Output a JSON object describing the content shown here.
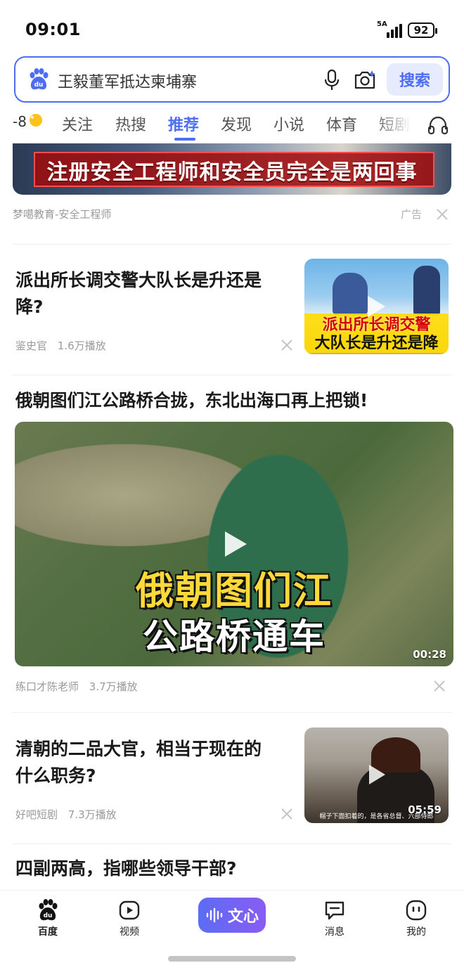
{
  "status_bar": {
    "time": "09:01",
    "network": "5A",
    "battery": "92"
  },
  "search": {
    "query": "王毅董军抵达柬埔寨",
    "button_label": "搜索"
  },
  "tabs": {
    "weather": "-8",
    "items": [
      "关注",
      "热搜",
      "推荐",
      "发现",
      "小说",
      "体育",
      "短剧"
    ],
    "active": "推荐"
  },
  "feed": {
    "ad": {
      "banner_text": "注册安全工程师和安全员完全是两回事",
      "source": "梦噶教育-安全工程师",
      "label": "广告"
    },
    "item1": {
      "title_line1": "派出所长调交警大队长是升还是",
      "title_line2": "降?",
      "author": "鉴史官",
      "plays": "1.6万播放",
      "thumb_caption_1": "派出所长调交警",
      "thumb_caption_2": "大队长是升还是降"
    },
    "item2": {
      "title": "俄朝图们江公路桥合拢，东北出海口再上把锁!",
      "thumb_caption_1": "俄朝图们江",
      "thumb_caption_2": "公路桥通车",
      "duration": "00:28",
      "author": "练口才陈老师",
      "plays": "3.7万播放"
    },
    "item3": {
      "title_line1": "清朝的二品大官，相当于现在的",
      "title_line2": "什么职务?",
      "author": "好吧短剧",
      "plays": "7.3万播放",
      "duration": "05:59",
      "thumb_subtitle": "帽子下面扣着的，是各省总督、六部侍郎"
    },
    "item4": {
      "title": "四副两高，指哪些领导干部?"
    }
  },
  "bottom_nav": {
    "home": "百度",
    "video": "视频",
    "wenxin": "文心",
    "messages": "消息",
    "mine": "我的"
  },
  "colors": {
    "accent": "#4e6ef2",
    "text": "#1a1a1a",
    "meta": "#9a9a9a"
  }
}
